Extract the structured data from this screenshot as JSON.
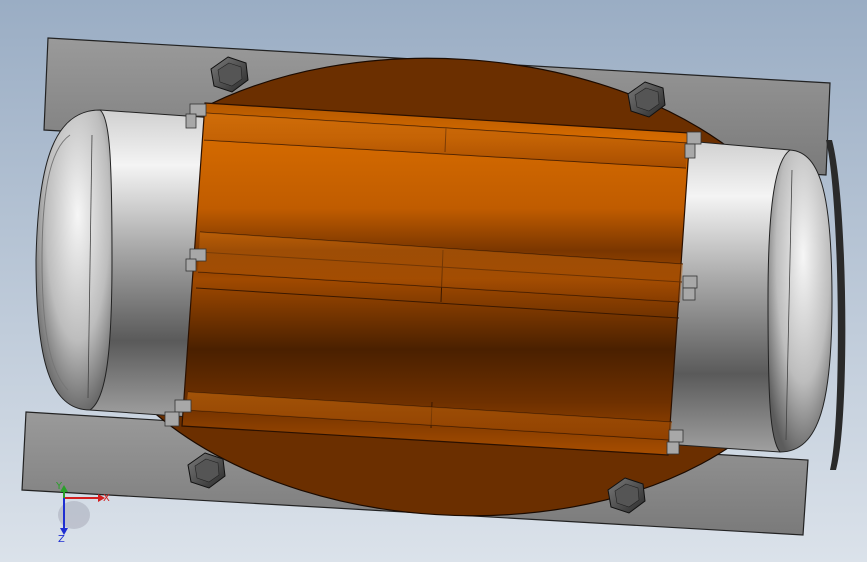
{
  "viewport": {
    "background_top": "#9aadc4",
    "background_bottom": "#d9e0e8"
  },
  "model": {
    "plate_color": "#8a8a8a",
    "base_color": "#6b2f00",
    "housing_color": "#c86400",
    "housing_dark": "#5a2800",
    "cylinder_light": "#e4e4e4",
    "cylinder_dark": "#4e4e4e",
    "bolt_color": "#3c3c3c"
  },
  "triad": {
    "x_label": "X",
    "y_label": "Y",
    "z_label": "Z",
    "x_color": "#d21e1e",
    "y_color": "#2aa02a",
    "z_color": "#1e2ed2"
  }
}
